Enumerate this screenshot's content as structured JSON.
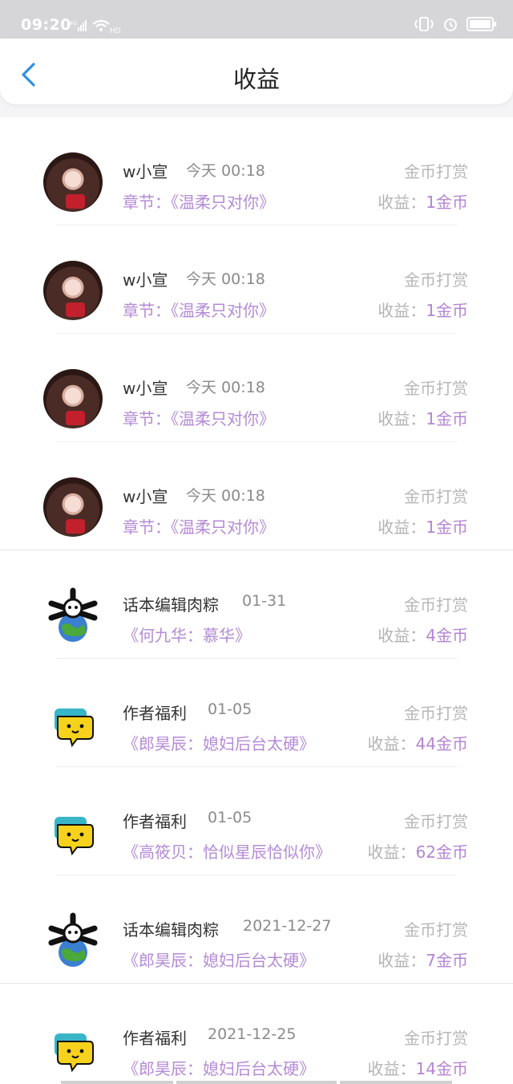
{
  "status_bar": {
    "time": "09:20",
    "network": "4G",
    "hd": "HD"
  },
  "header": {
    "title": "收益"
  },
  "list": {
    "items": [
      {
        "name": "w小宣",
        "time": "今天 00:18",
        "type": "金币打赏",
        "chapter_prefix": "章节：",
        "chapter": "《温柔只对你》",
        "earn_label": "收益：",
        "earn_value": "1金币",
        "avatar": "photo"
      },
      {
        "name": "w小宣",
        "time": "今天 00:18",
        "type": "金币打赏",
        "chapter_prefix": "章节：",
        "chapter": "《温柔只对你》",
        "earn_label": "收益：",
        "earn_value": "1金币",
        "avatar": "photo"
      },
      {
        "name": "w小宣",
        "time": "今天 00:18",
        "type": "金币打赏",
        "chapter_prefix": "章节：",
        "chapter": "《温柔只对你》",
        "earn_label": "收益：",
        "earn_value": "1金币",
        "avatar": "photo"
      },
      {
        "name": "w小宣",
        "time": "今天 00:18",
        "type": "金币打赏",
        "chapter_prefix": "章节：",
        "chapter": "《温柔只对你》",
        "earn_label": "收益：",
        "earn_value": "1金币",
        "avatar": "photo"
      },
      {
        "name": "话本编辑肉粽",
        "time": "01-31",
        "type": "金币打赏",
        "chapter_prefix": "",
        "chapter": "《何九华：慕华》",
        "earn_label": "收益：",
        "earn_value": "4金币",
        "avatar": "bone-globe"
      },
      {
        "name": "作者福利",
        "time": "01-05",
        "type": "金币打赏",
        "chapter_prefix": "",
        "chapter": "《郎昊辰：媳妇后台太硬》",
        "earn_label": "收益：",
        "earn_value": "44金币",
        "avatar": "chat-bubble"
      },
      {
        "name": "作者福利",
        "time": "01-05",
        "type": "金币打赏",
        "chapter_prefix": "",
        "chapter": "《高筱贝：恰似星辰恰似你》",
        "earn_label": "收益：",
        "earn_value": "62金币",
        "avatar": "chat-bubble"
      },
      {
        "name": "话本编辑肉粽",
        "time": "2021-12-27",
        "type": "金币打赏",
        "chapter_prefix": "",
        "chapter": "《郎昊辰：媳妇后台太硬》",
        "earn_label": "收益：",
        "earn_value": "7金币",
        "avatar": "bone-globe"
      },
      {
        "name": "作者福利",
        "time": "2021-12-25",
        "type": "金币打赏",
        "chapter_prefix": "",
        "chapter": "《郎昊辰：媳妇后台太硬》",
        "earn_label": "收益：",
        "earn_value": "14金币",
        "avatar": "chat-bubble"
      }
    ]
  },
  "colors": {
    "accent_purple": "#b484d3",
    "back_blue": "#2f8fe6"
  }
}
